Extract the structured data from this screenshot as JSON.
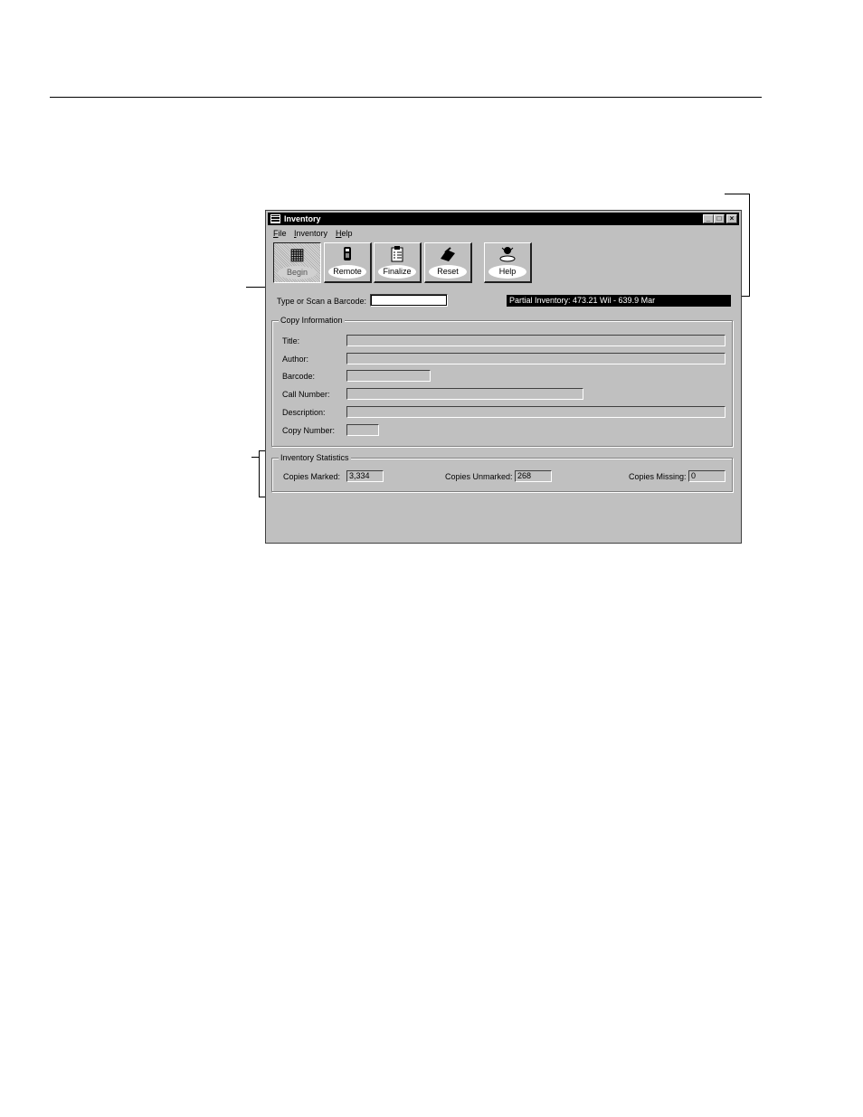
{
  "window": {
    "title": "Inventory",
    "controls": {
      "minimize": "_",
      "maximize": "□",
      "close": "×"
    }
  },
  "menu": [
    {
      "mnemonic": "F",
      "rest": "ile"
    },
    {
      "mnemonic": "I",
      "rest": "nventory"
    },
    {
      "mnemonic": "H",
      "rest": "elp"
    }
  ],
  "toolbar": {
    "begin": {
      "label": "Begin",
      "icon": "begin-icon",
      "state": "pressed"
    },
    "remote": {
      "label": "Remote",
      "icon": "remote-scanner-icon"
    },
    "finalize": {
      "label": "Finalize",
      "icon": "clipboard-icon"
    },
    "reset": {
      "label": "Reset",
      "icon": "reset-icon"
    },
    "help": {
      "label": "Help",
      "icon": "help-icon"
    }
  },
  "barcode": {
    "label": "Type or Scan a Barcode:",
    "value": ""
  },
  "status": "Partial Inventory: 473.21 Wil - 639.9 Mar",
  "copy_information": {
    "legend": "Copy Information",
    "title_label": "Title:",
    "title_value": "",
    "author_label": "Author:",
    "author_value": "",
    "barcode_label": "Barcode:",
    "barcode_value": "",
    "call_number_label": "Call Number:",
    "call_number_value": "",
    "description_label": "Description:",
    "description_value": "",
    "copy_number_label": "Copy Number:",
    "copy_number_value": ""
  },
  "inventory_statistics": {
    "legend": "Inventory Statistics",
    "marked_label": "Copies Marked:",
    "marked_value": "3,334",
    "unmarked_label": "Copies Unmarked:",
    "unmarked_value": "268",
    "missing_label": "Copies Missing:",
    "missing_value": "0"
  }
}
